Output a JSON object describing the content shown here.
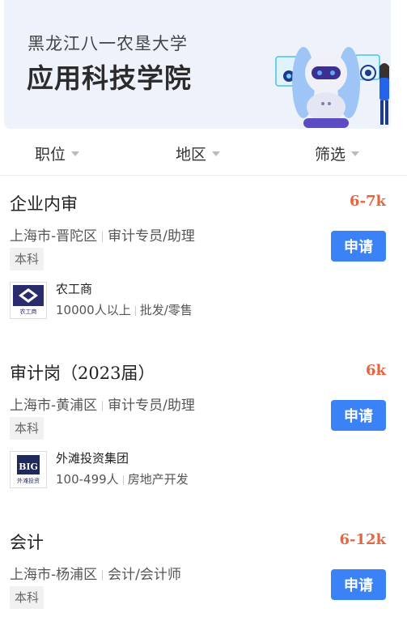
{
  "banner": {
    "subtitle": "黑龙江八一农垦大学",
    "title": "应用科技学院"
  },
  "filters": [
    {
      "label": "职位"
    },
    {
      "label": "地区"
    },
    {
      "label": "筛选"
    }
  ],
  "jobs": [
    {
      "title": "企业内审",
      "salary": "6-7k",
      "location": "上海市-晋陀区",
      "category": "审计专员/助理",
      "education": "本科",
      "apply_label": "申请",
      "company": {
        "name": "农工商",
        "size": "10000人以上",
        "industry": "批发/零售",
        "logo_caption": "农工商"
      }
    },
    {
      "title": "审计岗（2023届）",
      "salary": "6k",
      "location": "上海市-黄浦区",
      "category": "审计专员/助理",
      "education": "本科",
      "apply_label": "申请",
      "company": {
        "name": "外滩投资集团",
        "size": "100-499人",
        "industry": "房地产开发",
        "logo_caption": "外滩投资"
      }
    },
    {
      "title": "会计",
      "salary": "6-12k",
      "location": "上海市-杨浦区",
      "category": "会计/会计师",
      "education": "本科",
      "apply_label": "申请"
    }
  ],
  "colors": {
    "salary": "#e6643e",
    "apply_button": "#3b82f6",
    "banner_bg": "#eef2fb"
  }
}
